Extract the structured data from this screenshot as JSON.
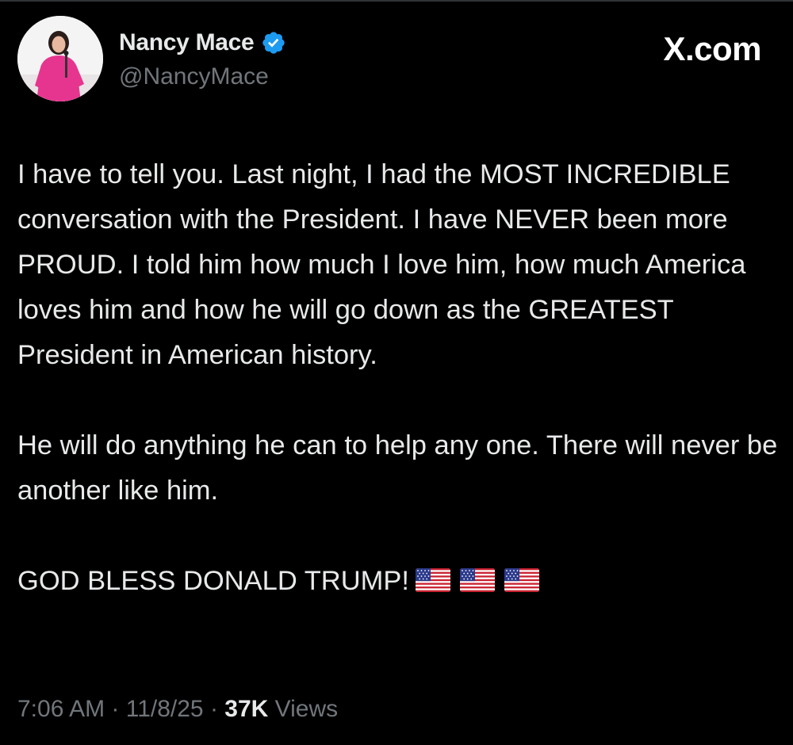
{
  "author": {
    "display_name": "Nancy Mace",
    "handle": "@NancyMace",
    "verified": true,
    "avatar_icon": "profile-photo-avatar"
  },
  "site_mark": "X.com",
  "tweet": {
    "paragraphs": [
      "I have to tell you. Last night, I had the MOST INCREDIBLE conversation with the President. I have NEVER been more PROUD. I told him how much I love him, how much America loves him and how he will go down as the GREATEST President in American history.",
      "He will do anything he can to help any one. There will never be another like him.",
      "GOD BLESS DONALD TRUMP!"
    ],
    "trailing_emoji": [
      "us-flag-icon",
      "us-flag-icon",
      "us-flag-icon"
    ]
  },
  "meta": {
    "time": "7:06 AM",
    "separator": " · ",
    "date": "11/8/25",
    "views_count": "37K",
    "views_label": " Views"
  },
  "colors": {
    "background": "#000000",
    "text": "#e7e9ea",
    "muted": "#71767b",
    "verified_blue": "#1d9bf0"
  }
}
